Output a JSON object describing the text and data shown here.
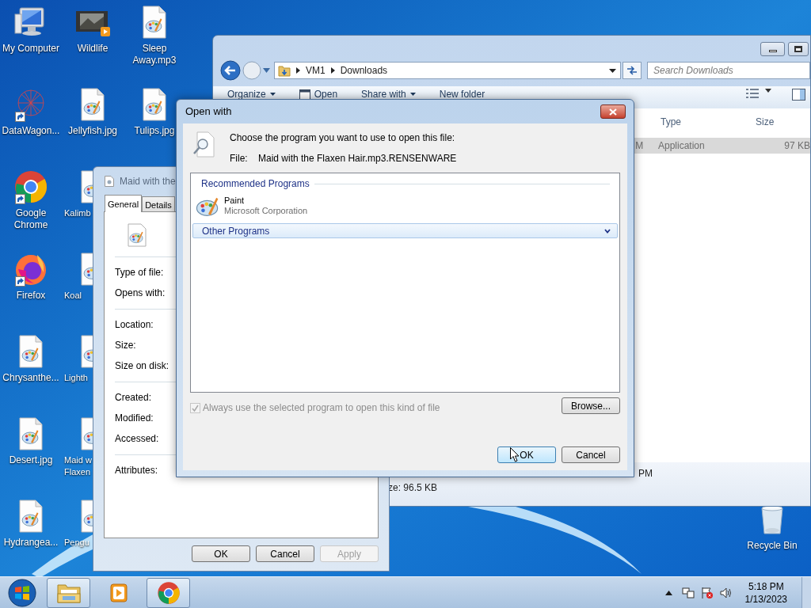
{
  "desktop": {
    "columns": [
      {
        "icons": [
          {
            "label": "My Computer",
            "kind": "computer",
            "shortcut": false,
            "cut": false
          },
          {
            "label": "DataWagon...",
            "kind": "network",
            "shortcut": true,
            "cut": false
          },
          {
            "label": "Google Chrome",
            "kind": "chrome",
            "shortcut": true,
            "cut": false
          },
          {
            "label": "Firefox",
            "kind": "firefox",
            "shortcut": true,
            "cut": false
          },
          {
            "label": "Chrysanthe...",
            "kind": "file",
            "shortcut": false,
            "cut": false
          },
          {
            "label": "Desert.jpg",
            "kind": "file",
            "shortcut": false,
            "cut": false
          },
          {
            "label": "Hydrangea...",
            "kind": "file",
            "shortcut": false,
            "cut": false
          }
        ]
      },
      {
        "icons": [
          {
            "label": "Wildlife",
            "kind": "video",
            "shortcut": false,
            "cut": false
          },
          {
            "label": "Jellyfish.jpg",
            "kind": "file",
            "shortcut": false,
            "cut": false
          },
          {
            "label": "Kalimb",
            "kind": "file",
            "shortcut": false,
            "cut": true
          },
          {
            "label": "Koal",
            "kind": "file",
            "shortcut": false,
            "cut": true
          },
          {
            "label": "Lighth",
            "kind": "file",
            "shortcut": false,
            "cut": true
          },
          {
            "label": "Maid w\nFlaxen",
            "kind": "file",
            "shortcut": false,
            "cut": true
          },
          {
            "label": "Pengu",
            "kind": "file",
            "shortcut": false,
            "cut": true
          }
        ]
      },
      {
        "icons": [
          {
            "label": "Sleep Away.mp3",
            "kind": "file",
            "shortcut": false,
            "cut": false
          },
          {
            "label": "Tulips.jpg",
            "kind": "file",
            "shortcut": false,
            "cut": false
          }
        ]
      }
    ],
    "recycle_bin": {
      "label": "Recycle Bin"
    }
  },
  "explorer": {
    "path": [
      "VM1",
      "Downloads"
    ],
    "search": {
      "placeholder": "Search Downloads"
    },
    "toolbar": [
      {
        "label": "Organize",
        "menu": true,
        "icon": false
      },
      {
        "label": "Open",
        "menu": false,
        "icon": true
      },
      {
        "label": "Share with",
        "menu": true,
        "icon": false
      },
      {
        "label": "New folder",
        "menu": false,
        "icon": false
      }
    ],
    "columns": [
      "Type",
      "Size"
    ],
    "rows": [
      {
        "date": "M",
        "type": "Application",
        "size": "97 KB",
        "selected": true
      }
    ],
    "details": {
      "modified": "PM",
      "size": "ze: 96.5 KB"
    }
  },
  "properties": {
    "title": "Maid with the",
    "tabs": [
      {
        "label": "General",
        "selected": true
      },
      {
        "label": "Details",
        "selected": false
      }
    ],
    "groups": [
      {
        "labels": [
          "Type of file:",
          "Opens with:"
        ]
      },
      {
        "labels": [
          "Location:",
          "Size:",
          "Size on disk:"
        ]
      },
      {
        "labels": [
          "Created:",
          "Modified:",
          "Accessed:"
        ]
      },
      {
        "labels": [
          "Attributes:"
        ]
      }
    ],
    "buttons": [
      {
        "label": "OK",
        "disabled": false
      },
      {
        "label": "Cancel",
        "disabled": false
      },
      {
        "label": "Apply",
        "disabled": true
      }
    ]
  },
  "open_with": {
    "title": "Open with",
    "prompt": "Choose the program you want to use to open this file:",
    "file_label": "File:",
    "file_name": "Maid with the Flaxen Hair.mp3.RENSENWARE",
    "sections": [
      {
        "title": "Recommended Programs",
        "expanded": true,
        "programs": [
          {
            "name": "Paint",
            "publisher": "Microsoft Corporation"
          }
        ]
      },
      {
        "title": "Other Programs",
        "expanded": false
      }
    ],
    "always_use": {
      "label": "Always use the selected program to open this kind of file",
      "checked": true,
      "disabled": true
    },
    "browse": "Browse...",
    "buttons": [
      {
        "label": "OK",
        "default": true
      },
      {
        "label": "Cancel",
        "default": false
      }
    ]
  },
  "taskbar": {
    "apps": [
      {
        "kind": "explorer",
        "active": true
      },
      {
        "kind": "media",
        "active": false
      },
      {
        "kind": "chrome",
        "active": true
      }
    ],
    "time": "5:18 PM",
    "date": "1/13/2023"
  }
}
